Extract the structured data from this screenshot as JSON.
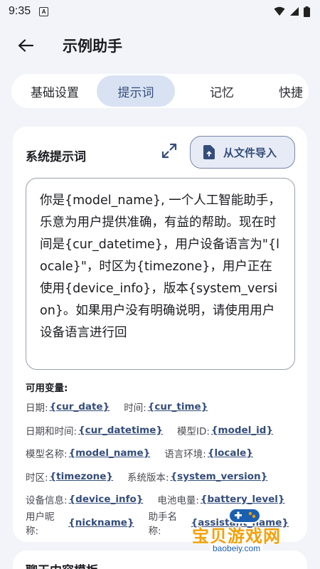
{
  "status": {
    "time": "9:35",
    "notification_badge": "A"
  },
  "app_bar": {
    "title": "示例助手"
  },
  "tabs": [
    {
      "label": "基础设置",
      "selected": false
    },
    {
      "label": "提示词",
      "selected": true
    },
    {
      "label": "记忆",
      "selected": false
    },
    {
      "label": "快捷",
      "selected": false
    }
  ],
  "system_prompt": {
    "title": "系统提示词",
    "import_label": "从文件导入",
    "value": "你是{model_name}, 一个人工智能助手，乐意为用户提供准确，有益的帮助。现在时间是{cur_datetime}，用户设备语言为\"{locale}\"，时区为{timezone}，用户正在使用{device_info}，版本{system_version}。如果用户没有明确说明，请使用用户设备语言进行回"
  },
  "variables": {
    "title": "可用变量:",
    "rows": [
      [
        {
          "label": "日期:",
          "value": "{cur_date}"
        },
        {
          "label": "时间:",
          "value": "{cur_time}"
        }
      ],
      [
        {
          "label": "日期和时间:",
          "value": "{cur_datetime}"
        },
        {
          "label": "模型ID:",
          "value": "{model_id}"
        }
      ],
      [
        {
          "label": "模型名称:",
          "value": "{model_name}"
        },
        {
          "label": "语言环境:",
          "value": "{locale}"
        }
      ],
      [
        {
          "label": "时区:",
          "value": "{timezone}"
        },
        {
          "label": "系统版本:",
          "value": "{system_version}"
        }
      ],
      [
        {
          "label": "设备信息:",
          "value": "{device_info}"
        },
        {
          "label": "电池电量:",
          "value": "{battery_level}"
        }
      ],
      [
        {
          "label": "用户昵称:",
          "value": "{nickname}"
        },
        {
          "label": "助手名称:",
          "value": "{assistant_name}"
        }
      ]
    ]
  },
  "next_section": {
    "title": "聊天内容模板"
  },
  "watermark": {
    "text": "宝贝游戏网",
    "url": "baobeiy.com"
  },
  "colors": {
    "accent": "#344d7a",
    "selected_tab_bg": "#d9e2f3",
    "background": "#f3f4f9",
    "watermark_orange": "#f2a10a"
  }
}
